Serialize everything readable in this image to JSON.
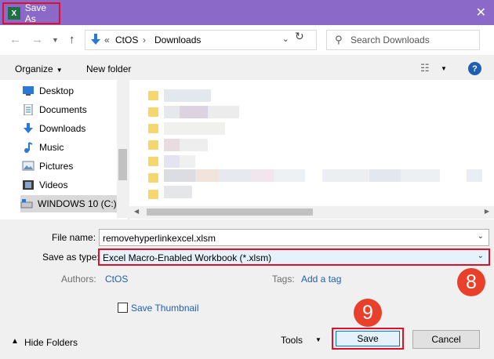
{
  "window": {
    "title": "Save As",
    "app_icon": "X"
  },
  "nav": {
    "breadcrumb": [
      "CtOS",
      "Downloads"
    ],
    "overflow": "«",
    "search_placeholder": "Search Downloads"
  },
  "toolbar": {
    "organize": "Organize",
    "new_folder": "New folder",
    "help": "?"
  },
  "sidebar": {
    "items": [
      {
        "label": "Desktop",
        "icon": "desktop-icon"
      },
      {
        "label": "Documents",
        "icon": "documents-icon"
      },
      {
        "label": "Downloads",
        "icon": "downloads-icon"
      },
      {
        "label": "Music",
        "icon": "music-icon"
      },
      {
        "label": "Pictures",
        "icon": "pictures-icon"
      },
      {
        "label": "Videos",
        "icon": "videos-icon"
      },
      {
        "label": "WINDOWS 10 (C:)",
        "icon": "drive-icon"
      }
    ]
  },
  "form": {
    "file_name_label": "File name:",
    "file_name_value": "removehyperlinkexcel.xlsm",
    "save_type_label": "Save as type:",
    "save_type_value": "Excel Macro-Enabled Workbook (*.xlsm)",
    "authors_label": "Authors:",
    "authors_value": "CtOS",
    "tags_label": "Tags:",
    "tags_value": "Add a tag",
    "thumbnail_label": "Save Thumbnail"
  },
  "footer": {
    "hide_folders": "Hide Folders",
    "tools": "Tools",
    "save": "Save",
    "cancel": "Cancel"
  },
  "annotations": {
    "step_8": "8",
    "step_9": "9"
  },
  "colors": {
    "titlebar": "#8b69c9",
    "highlight": "#e0102a",
    "badge": "#e8402a",
    "link": "#1f5fb4"
  }
}
